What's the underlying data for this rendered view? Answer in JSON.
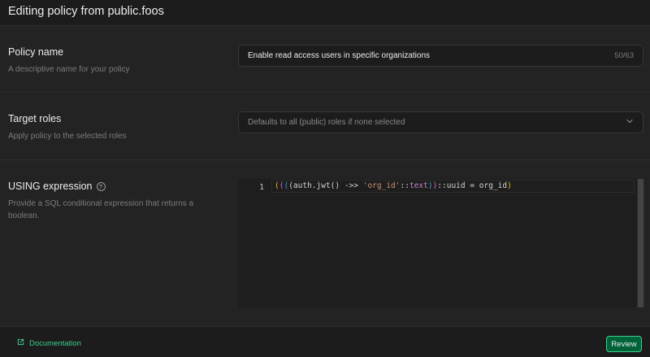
{
  "header": {
    "title": "Editing policy from public.foos"
  },
  "policy_name": {
    "label": "Policy name",
    "description": "A descriptive name for your policy",
    "value": "Enable read access users in specific organizations",
    "char_count": "50/63"
  },
  "target_roles": {
    "label": "Target roles",
    "description": "Apply policy to the selected roles",
    "placeholder": "Defaults to all (public) roles if none selected"
  },
  "using_expression": {
    "label": "USING expression",
    "description": "Provide a SQL conditional expression that returns a boolean.",
    "line_number": "1",
    "code": {
      "t1": "(",
      "t2": "(",
      "t3": "(",
      "t4": "(auth.jwt() ->> ",
      "t5": "'org_id'",
      "t6": "::",
      "t7": "text",
      "t8": ")",
      "t9": ")",
      "t10": "::uuid = org_id",
      "t11": ")"
    }
  },
  "footer": {
    "documentation_label": "Documentation",
    "review_label": "Review"
  },
  "colors": {
    "accent": "#3ecf8e",
    "background": "#1c1c1c",
    "panel": "#232323"
  }
}
